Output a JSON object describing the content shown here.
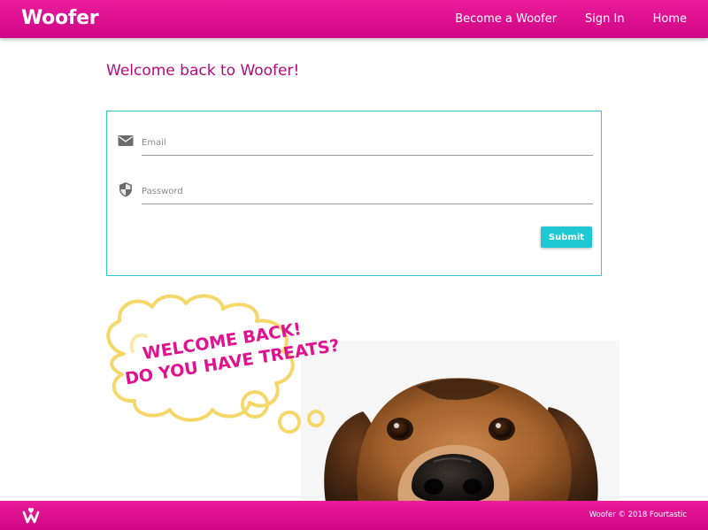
{
  "navbar": {
    "brand": "Woofer",
    "links": [
      "Become a Woofer",
      "Sign In",
      "Home"
    ]
  },
  "page": {
    "heading": "Welcome back to Woofer!"
  },
  "form": {
    "email_placeholder": "Email",
    "password_placeholder": "Password",
    "submit_label": "Submit"
  },
  "hero": {
    "bubble_line1": "WELCOME BACK!",
    "bubble_line2": "DO YOU HAVE TREATS?"
  },
  "footer": {
    "copyright": "Woofer © 2018 Fourtastic"
  },
  "colors": {
    "brand_pink": "#e0128f",
    "accent_teal": "#1fc8d2",
    "heading_magenta": "#b60a7e",
    "bubble_yellow": "#f5d76a"
  },
  "icons": [
    "woofer-logo-icon",
    "mail-icon",
    "shield-icon"
  ]
}
